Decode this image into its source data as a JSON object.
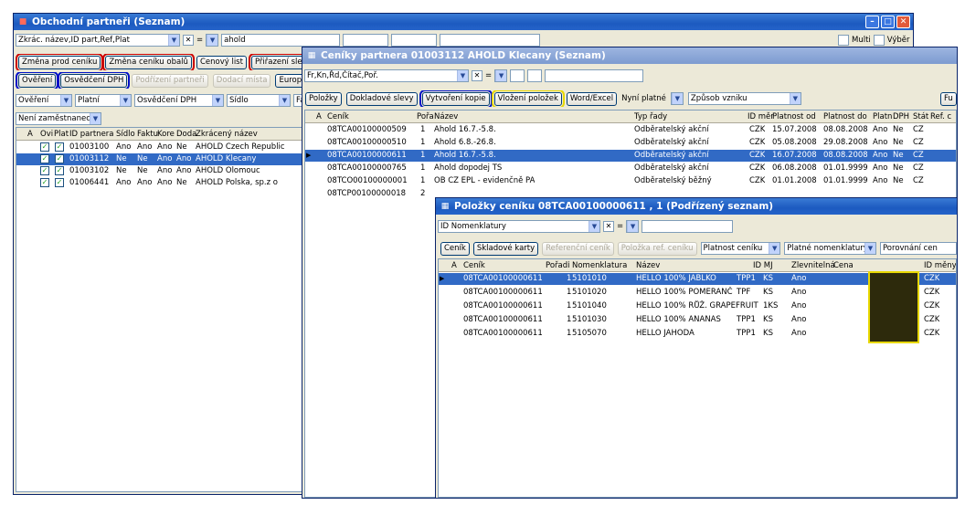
{
  "w1": {
    "title": "Obchodní partneři (Seznam)",
    "filter_combo": "Zkrác. název,ID part,Ref,Plat",
    "op": "=",
    "filter_value": "ahold",
    "multi_label": "Multi",
    "vyber_label": "Výběr",
    "btn_zmena_prod": "Změna prod ceníku",
    "btn_zmena_obalu": "Změna ceníku obalů",
    "btn_cenovy_list": "Cenový list",
    "btn_prirazeni": "Přiřazení slev. sk",
    "btn_overeni": "Ověření",
    "btn_osvedceni": "Osvědčení DPH",
    "btn_podrizeni": "Podřízení partneři",
    "btn_dodaci": "Dodací místa",
    "btn_europa": "Europa.e",
    "f_overeni": "Ověření",
    "f_platni": "Platní",
    "f_osvedceni": "Osvědčení DPH",
    "f_sidlo": "Sídlo",
    "f_fak": "Fak",
    "f_zam": "Není zaměstnanec",
    "headers": [
      "A",
      "Ovi",
      "Plat",
      "ID partnera",
      "Sídlo",
      "Faktu",
      "Kore",
      "Doda",
      "Zkrácený název"
    ],
    "rows": [
      {
        "id": "01003100",
        "s": "Ano",
        "f": "Ano",
        "k": "Ano",
        "d": "Ne",
        "n": "AHOLD Czech Republic"
      },
      {
        "id": "01003112",
        "s": "Ne",
        "f": "Ne",
        "k": "Ano",
        "d": "Ano",
        "n": "AHOLD Klecany"
      },
      {
        "id": "01003102",
        "s": "Ne",
        "f": "Ne",
        "k": "Ano",
        "d": "Ano",
        "n": "AHOLD Olomouc"
      },
      {
        "id": "01006441",
        "s": "Ano",
        "f": "Ano",
        "k": "Ano",
        "d": "Ne",
        "n": "AHOLD Polska, sp.z o"
      }
    ]
  },
  "w2": {
    "title": "Ceníky partnera 01003112 AHOLD Klecany (Seznam)",
    "filter_combo": "Fr,Kn,Řd,Čítač,Poř.",
    "op": "=",
    "btn_polozky": "Položky",
    "btn_dokladove": "Dokladové slevy",
    "btn_vytvoreni": "Vytvoření kopie",
    "btn_vlozeni": "Vložení položek",
    "btn_word": "Word/Excel",
    "lbl_nyni": "Nyní platné",
    "f_zpusob": "Způsob vzniku",
    "btn_fu": "Fu",
    "headers": [
      "A",
      "Ceník",
      "Pořa",
      "Název",
      "Typ řady",
      "ID měr",
      "Platnost od",
      "Platnost do",
      "Platn",
      "DPH",
      "Stát",
      "Ref. c"
    ],
    "rows": [
      {
        "c": "08TCA00100000509",
        "p": "1",
        "n": "Ahold 16.7.-5.8.",
        "t": "Odběratelský akční",
        "m": "CZK",
        "od": "15.07.2008",
        "do": "08.08.2008",
        "pl": "Ano",
        "dph": "Ne",
        "st": "CZ"
      },
      {
        "c": "08TCA00100000510",
        "p": "1",
        "n": "Ahold 6.8.-26.8.",
        "t": "Odběratelský akční",
        "m": "CZK",
        "od": "05.08.2008",
        "do": "29.08.2008",
        "pl": "Ano",
        "dph": "Ne",
        "st": "CZ"
      },
      {
        "c": "08TCA00100000611",
        "p": "1",
        "n": "Ahold 16.7.-5.8.",
        "t": "Odběratelský akční",
        "m": "CZK",
        "od": "16.07.2008",
        "do": "08.08.2008",
        "pl": "Ano",
        "dph": "Ne",
        "st": "CZ"
      },
      {
        "c": "08TCA00100000765",
        "p": "1",
        "n": "Ahold dopodej TS",
        "t": "Odběratelský akční",
        "m": "CZK",
        "od": "06.08.2008",
        "do": "01.01.9999",
        "pl": "Ano",
        "dph": "Ne",
        "st": "CZ"
      },
      {
        "c": "08TCO00100000001",
        "p": "1",
        "n": "OB CZ  EPL - evidenčně PA",
        "t": "Odběratelský běžný",
        "m": "CZK",
        "od": "01.01.2008",
        "do": "01.01.9999",
        "pl": "Ano",
        "dph": "Ne",
        "st": "CZ"
      },
      {
        "c": "08TCP00100000018",
        "p": "2",
        "n": "",
        "t": "",
        "m": "",
        "od": "",
        "do": "",
        "pl": "",
        "dph": "",
        "st": ""
      }
    ]
  },
  "w3": {
    "title": "Položky ceníku 08TCA00100000611 , 1 (Podřízený seznam)",
    "filter_combo": "ID Nomenklatury",
    "op": "=",
    "btn_cenik": "Ceník",
    "btn_skladove": "Skladové karty",
    "btn_referencni": "Referenční ceník",
    "btn_polozka_ref": "Položka ref. ceníku",
    "f_platnost": "Platnost ceníku",
    "f_nomenklatury": "Platné nomenklatury",
    "f_porovnani": "Porovnání cen",
    "headers": [
      "A",
      "Ceník",
      "Pořadí",
      "Nomenklatura",
      "Název",
      "ID MJ",
      "Zlevnitelná",
      "Cena",
      "ID měny"
    ],
    "rows": [
      {
        "c": "08TCA00100000611",
        "p": "1",
        "nom": "5101010",
        "n": "HELLO 100% JABLKO",
        "t": "TPP1",
        "mj": "KS",
        "z": "Ano",
        "m": "CZK"
      },
      {
        "c": "08TCA00100000611",
        "p": "1",
        "nom": "5101020",
        "n": "HELLO 100% POMERANČ",
        "t": "TPF",
        "mj": "KS",
        "z": "Ano",
        "m": "CZK"
      },
      {
        "c": "08TCA00100000611",
        "p": "1",
        "nom": "5101040",
        "n": "HELLO 100% RŮŽ. GRAPEFRUIT",
        "t": "",
        "mj": "1KS",
        "z": "Ano",
        "m": "CZK"
      },
      {
        "c": "08TCA00100000611",
        "p": "1",
        "nom": "5101030",
        "n": "HELLO 100% ANANAS",
        "t": "TPP1",
        "mj": "KS",
        "z": "Ano",
        "m": "CZK"
      },
      {
        "c": "08TCA00100000611",
        "p": "1",
        "nom": "5105070",
        "n": "HELLO JAHODA",
        "t": "TPP1",
        "mj": "KS",
        "z": "Ano",
        "m": "CZK"
      }
    ]
  }
}
